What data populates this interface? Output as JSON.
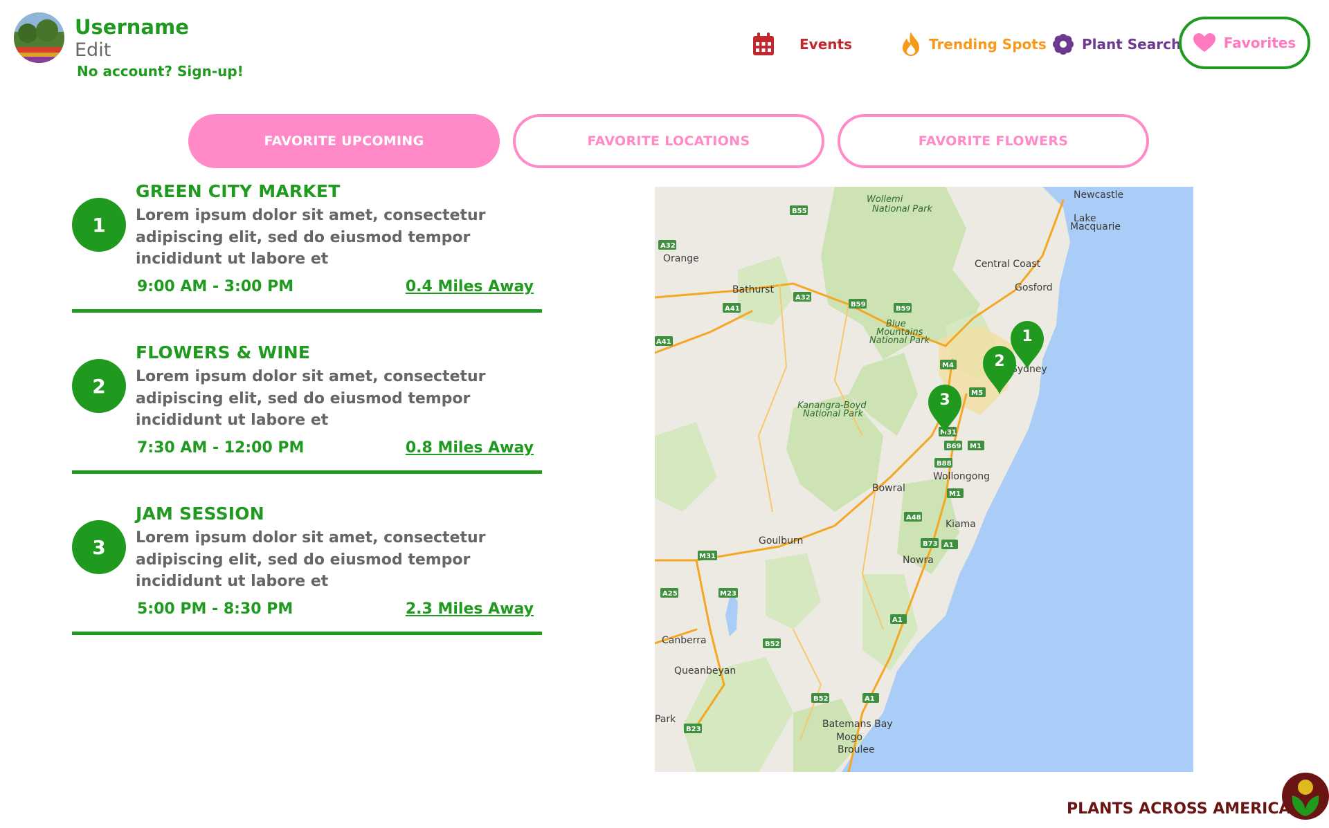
{
  "user": {
    "username": "Username",
    "edit_label": "Edit",
    "signup_label": "No account? Sign-up!"
  },
  "nav": {
    "events": {
      "label": "Events",
      "icon": "calendar-icon",
      "color": "#c0282d"
    },
    "trending": {
      "label": "Trending Spots",
      "icon": "flame-icon",
      "color": "#f59a1b"
    },
    "plant_search": {
      "label": "Plant Search",
      "icon": "flower-icon",
      "color": "#6c3b8f"
    },
    "favorites": {
      "label": "Favorites",
      "icon": "heart-icon",
      "color": "#ff79bf",
      "active": true
    }
  },
  "tabs": [
    {
      "label": "FAVORITE UPCOMING",
      "active": true
    },
    {
      "label": "FAVORITE LOCATIONS",
      "active": false
    },
    {
      "label": "FAVORITE FLOWERS",
      "active": false
    }
  ],
  "events": [
    {
      "number": "1",
      "title": "GREEN CITY MARKET",
      "description": "Lorem ipsum dolor sit amet, consectetur adipiscing elit, sed do eiusmod tempor incididunt ut labore et",
      "time": "9:00 AM - 3:00 PM",
      "distance": "0.4 Miles Away"
    },
    {
      "number": "2",
      "title": "FLOWERS & WINE",
      "description": "Lorem ipsum dolor sit amet, consectetur adipiscing elit, sed do eiusmod tempor incididunt ut labore et",
      "time": "7:30 AM - 12:00 PM",
      "distance": "0.8 Miles Away"
    },
    {
      "number": "3",
      "title": "JAM SESSION",
      "description": "Lorem ipsum dolor sit amet, consectetur adipiscing elit, sed do eiusmod tempor incididunt ut labore et",
      "time": "5:00 PM - 8:30 PM",
      "distance": "2.3 Miles Away"
    }
  ],
  "map": {
    "places": [
      "Newcastle",
      "Lake Macquarie",
      "Central Coast",
      "Gosford",
      "Orange",
      "Bathurst",
      "Sydney",
      "Wollongong",
      "Bowral",
      "Kiama",
      "Goulburn",
      "Nowra",
      "Canberra",
      "Queanbeyan",
      "Batemans Bay",
      "Mogo",
      "Broulee",
      "Park"
    ],
    "parks": [
      "Wollemi National Park",
      "Blue Mountains National Park",
      "Kanangra-Boyd National Park"
    ],
    "roads": [
      "B55",
      "A32",
      "A41",
      "B59",
      "M4",
      "M5",
      "M31",
      "B69",
      "M1",
      "B88",
      "A48",
      "B73",
      "A1",
      "A25",
      "M23",
      "B52",
      "B23"
    ],
    "pins": [
      "1",
      "2",
      "3"
    ]
  },
  "brand": {
    "name": "PLANTS ACROSS AMERICA"
  },
  "colors": {
    "green": "#1f9a1f",
    "pink": "#ff8ac7",
    "gray_text": "#666666",
    "brand": "#6b1414"
  }
}
